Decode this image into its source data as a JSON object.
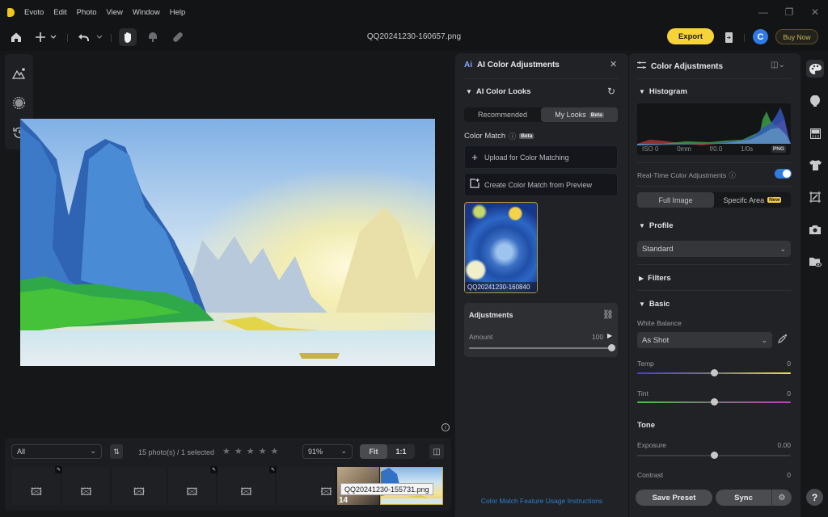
{
  "app": {
    "name": "Evoto",
    "menu": [
      "Evoto",
      "Edit",
      "Photo",
      "View",
      "Window",
      "Help"
    ],
    "window_controls": {
      "minimize": "—",
      "restore": "❐",
      "close": "✕"
    }
  },
  "toolbar": {
    "file_title": "QQ20241230-160657.png",
    "export_label": "Export",
    "avatar_initial": "C",
    "buy_now_label": "Buy Now",
    "icons": [
      "home-icon",
      "add-icon",
      "undo-icon",
      "hand-icon",
      "brush-icon",
      "bandage-icon",
      "import-icon"
    ]
  },
  "left_tools": [
    "ai-scene-icon",
    "filter-blur-icon",
    "history-icon"
  ],
  "filmstrip": {
    "filter_value": "All",
    "photo_count": "15 photo(s) / 1 selected",
    "stars": 0,
    "zoom_value": "91%",
    "fit_label": "Fit",
    "one_to_one_label": "1:1",
    "tooltip": "QQ20241230-155731.png",
    "index_label": "14"
  },
  "ai_panel": {
    "title": "AI Color Adjustments",
    "section": "AI Color Looks",
    "tabs": [
      {
        "label": "Recommended",
        "active": false
      },
      {
        "label": "My Looks",
        "active": true,
        "badge": "Beta"
      }
    ],
    "color_match_label": "Color Match",
    "color_match_badge": "Beta",
    "upload_label": "Upload for Color Matching",
    "create_label": "Create Color Match from Preview",
    "look_name": "QQ20241230-160840",
    "adjustments_title": "Adjustments",
    "amount_label": "Amount",
    "amount_value": "100",
    "amount_fraction": 1.0,
    "usage_link": "Color Match Feature Usage Instructions"
  },
  "color_panel": {
    "title": "Color Adjustments",
    "histogram_title": "Histogram",
    "meta": {
      "iso": "ISO 0",
      "focal": "0mm",
      "aperture": "f/0.0",
      "shutter": "1/0s",
      "format": "PNG"
    },
    "realtime_label": "Real-Time Color Adjustments",
    "realtime_on": true,
    "area_tabs": [
      {
        "label": "Full Image",
        "active": true
      },
      {
        "label": "Specifc Area",
        "badge": "New",
        "active": false
      }
    ],
    "profile_title": "Profile",
    "profile_value": "Standard",
    "filters_title": "Filters",
    "basic_title": "Basic",
    "white_balance_label": "White Balance",
    "white_balance_value": "As Shot",
    "temp_label": "Temp",
    "temp_value": "0",
    "tint_label": "Tint",
    "tint_value": "0",
    "tone_title": "Tone",
    "exposure_label": "Exposure",
    "exposure_value": "0.00",
    "contrast_label": "Contrast",
    "contrast_value": "0",
    "save_preset_label": "Save Preset",
    "sync_label": "Sync",
    "help_label": "?"
  },
  "right_rail": [
    "color-palette-icon",
    "face-icon",
    "background-icon",
    "clothing-icon",
    "crop-icon",
    "camera-icon",
    "folder-preview-icon"
  ],
  "colors": {
    "accent_yellow": "#f7d33a",
    "accent_blue": "#2f7de0",
    "link_blue": "#2d7fd0"
  }
}
